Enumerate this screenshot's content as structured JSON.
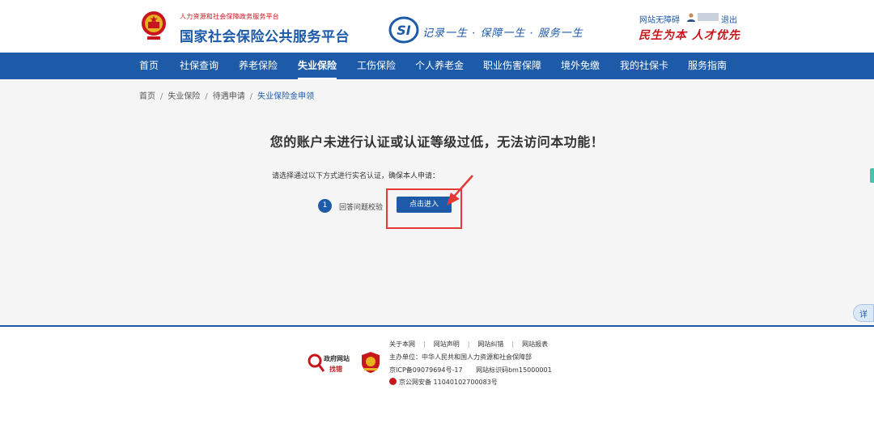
{
  "header": {
    "site_subtitle": "人力资源和社会保障政务服务平台",
    "site_title": "国家社会保险公共服务平台",
    "si_logo_text": "SI",
    "slogan": "记录一生 · 保障一生 · 服务一生",
    "accessibility": "网站无障碍",
    "logout": "退出",
    "motto": "民生为本 人才优先"
  },
  "nav": {
    "items": [
      {
        "label": "首页"
      },
      {
        "label": "社保查询"
      },
      {
        "label": "养老保险"
      },
      {
        "label": "失业保险"
      },
      {
        "label": "工伤保险"
      },
      {
        "label": "个人养老金"
      },
      {
        "label": "职业伤害保障"
      },
      {
        "label": "境外免缴"
      },
      {
        "label": "我的社保卡"
      },
      {
        "label": "服务指南"
      }
    ],
    "active_index": 3
  },
  "breadcrumb": {
    "items": [
      "首页",
      "失业保险",
      "待遇申请",
      "失业保险金申领"
    ]
  },
  "notice": {
    "title": "您的账户未进行认证或认证等级过低，无法访问本功能！",
    "description": "请选择通过以下方式进行实名认证，确保本人申请：",
    "step_number": "1",
    "step_label": "回答问题校验",
    "button_label": "点击进入"
  },
  "float_button": "详",
  "footer": {
    "gov_badge_line1": "政府网站",
    "gov_badge_line2": "找错",
    "links": [
      "关于本网",
      "网站声明",
      "网站纠错",
      "网站报表"
    ],
    "sponsor": "主办单位：中华人民共和国人力资源和社会保障部",
    "icp": "京ICP备09079694号-17",
    "site_code": "网站标识码bm15000001",
    "police_record": "京公网安备 11040102700083号"
  },
  "colors": {
    "brand_blue": "#1d5aa8",
    "accent_red": "#c8161d",
    "highlight_red": "#e53935",
    "content_bg": "#f5f5f5"
  }
}
